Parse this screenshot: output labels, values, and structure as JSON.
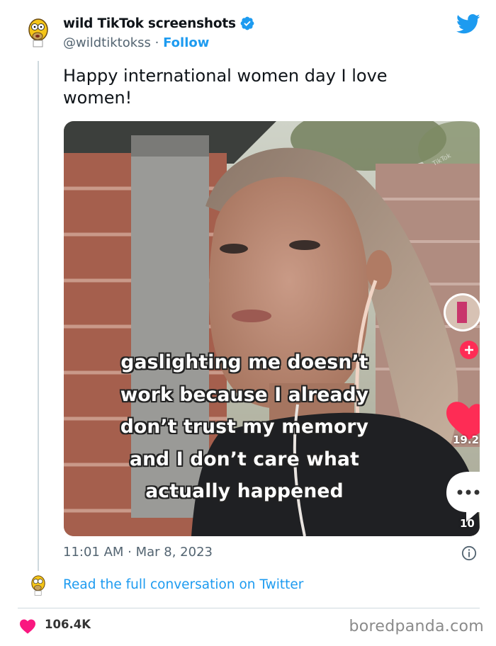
{
  "tweet": {
    "author_name": "wild TikTok screenshots",
    "author_handle": "@wildtiktokss",
    "separator": "·",
    "follow_label": "Follow",
    "text": "Happy international women day I love women!",
    "timestamp": "11:01 AM · Mar 8, 2023",
    "read_more": "Read the full conversation on Twitter"
  },
  "media": {
    "caption_lines": [
      "gaslighting me doesn’t",
      "work because I already",
      "don’t trust my memory",
      "and I don’t care what",
      "actually happened"
    ],
    "like_count": "19.2",
    "comment_count": "10"
  },
  "footer": {
    "likes": "106.4K",
    "brand": "boredpanda.com"
  },
  "icons": {
    "verified": "verified-badge-icon",
    "twitter": "twitter-bird-icon",
    "info": "info-icon",
    "heart": "heart-icon"
  },
  "colors": {
    "accent": "#1d9bf0",
    "heart": "#f91880",
    "text_secondary": "#536471"
  }
}
